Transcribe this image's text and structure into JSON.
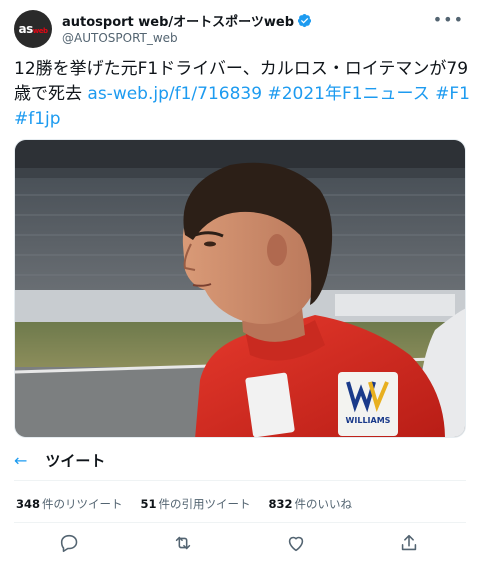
{
  "account": {
    "avatar_text": "as",
    "avatar_sub": "web",
    "display_name": "autosport web/オートスポーツweb",
    "handle": "@AUTOSPORT_web"
  },
  "tweet": {
    "text_part1": "12勝を挙げた元F1ドライバー、カルロス・ロイテマンが79歳で死去",
    "link": "as-web.jp/f1/716839",
    "hashtag1": "#2021年F1ニュース",
    "hashtag2": "#F1",
    "hashtag3": "#f1jp"
  },
  "translate": {
    "label": "ツイート"
  },
  "stats": {
    "retweets_count": "348",
    "retweets_label": "件のリツイート",
    "quotes_count": "51",
    "quotes_label": "件の引用ツイート",
    "likes_count": "832",
    "likes_label": "件のいいね"
  },
  "photo": {
    "sponsor": "WILLIAMS"
  },
  "colors": {
    "accent": "#1d9bf0",
    "verified": "#1d9bf0",
    "suit_red": "#d7261e"
  },
  "icons": [
    "more-icon",
    "verified-icon",
    "back-arrow-icon",
    "reply-icon",
    "retweet-icon",
    "like-icon",
    "share-icon"
  ]
}
